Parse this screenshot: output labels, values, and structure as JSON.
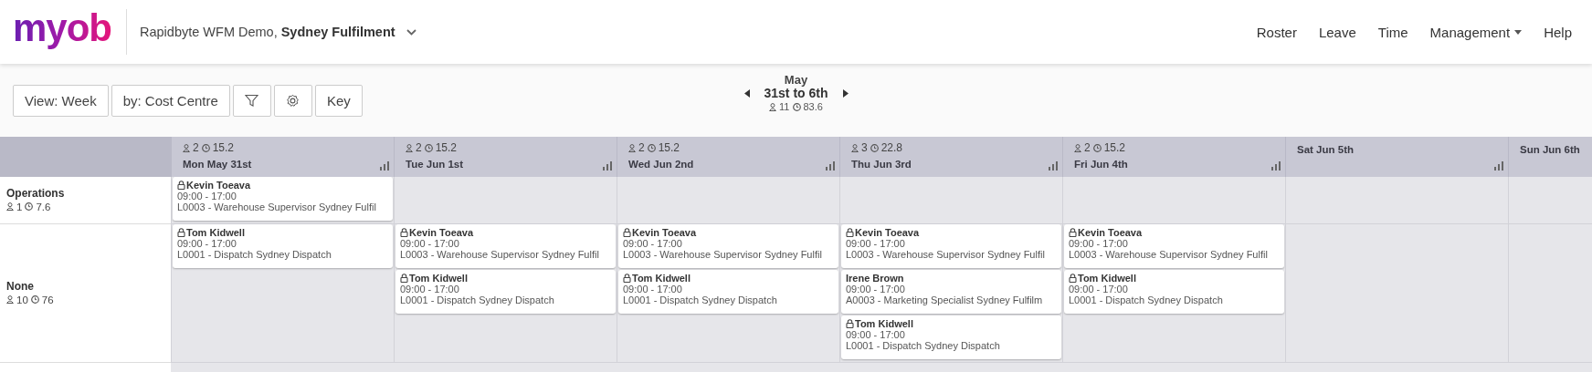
{
  "header": {
    "logo": "myob",
    "business": "Rapidbyte WFM Demo,",
    "location": "Sydney Fulfilment",
    "nav": [
      {
        "label": "Roster",
        "dropdown": false
      },
      {
        "label": "Leave",
        "dropdown": false
      },
      {
        "label": "Time",
        "dropdown": false
      },
      {
        "label": "Management",
        "dropdown": true
      },
      {
        "label": "Help",
        "dropdown": false
      }
    ]
  },
  "toolbar": {
    "buttons": [
      {
        "kind": "text",
        "label": "View: Week"
      },
      {
        "kind": "text",
        "label": "by: Cost Centre"
      },
      {
        "kind": "filter"
      },
      {
        "kind": "settings"
      },
      {
        "kind": "text",
        "label": "Key"
      }
    ],
    "period": {
      "month": "May",
      "range": "31st to 6th",
      "people": "11",
      "hours": "83.6"
    }
  },
  "days": [
    {
      "label": "Mon May 31st",
      "people": "2",
      "hours": "15.2"
    },
    {
      "label": "Tue Jun 1st",
      "people": "2",
      "hours": "15.2"
    },
    {
      "label": "Wed Jun 2nd",
      "people": "2",
      "hours": "15.2"
    },
    {
      "label": "Thu Jun 3rd",
      "people": "3",
      "hours": "22.8"
    },
    {
      "label": "Fri Jun 4th",
      "people": "2",
      "hours": "15.2"
    },
    {
      "label": "Sat Jun 5th"
    },
    {
      "label": "Sun Jun 6th"
    }
  ],
  "rows": [
    {
      "name": "Operations",
      "people": "1",
      "hours": "7.6",
      "days": [
        {
          "kind": "shifts",
          "shifts": [
            {
              "employee": "Kevin Toeava",
              "locked": true,
              "time": "09:00 - 17:00",
              "role": "L0003 - Warehouse Supervisor Sydney Fulfil"
            }
          ]
        },
        {
          "kind": "empty"
        },
        {
          "kind": "empty"
        },
        {
          "kind": "empty"
        },
        {
          "kind": "empty"
        },
        {
          "kind": "empty"
        },
        {
          "kind": "empty"
        }
      ]
    },
    {
      "name": "None",
      "people": "10",
      "hours": "76",
      "days": [
        {
          "kind": "shifts",
          "shifts": [
            {
              "employee": "Tom Kidwell",
              "locked": true,
              "time": "09:00 - 17:00",
              "role": "L0001 - Dispatch Sydney Dispatch"
            }
          ]
        },
        {
          "kind": "shifts",
          "shifts": [
            {
              "employee": "Kevin Toeava",
              "locked": true,
              "time": "09:00 - 17:00",
              "role": "L0003 - Warehouse Supervisor Sydney Fulfil"
            },
            {
              "employee": "Tom Kidwell",
              "locked": true,
              "time": "09:00 - 17:00",
              "role": "L0001 - Dispatch Sydney Dispatch"
            }
          ]
        },
        {
          "kind": "shifts",
          "shifts": [
            {
              "employee": "Kevin Toeava",
              "locked": true,
              "time": "09:00 - 17:00",
              "role": "L0003 - Warehouse Supervisor Sydney Fulfil"
            },
            {
              "employee": "Tom Kidwell",
              "locked": true,
              "time": "09:00 - 17:00",
              "role": "L0001 - Dispatch Sydney Dispatch"
            }
          ]
        },
        {
          "kind": "shifts",
          "shifts": [
            {
              "employee": "Kevin Toeava",
              "locked": true,
              "time": "09:00 - 17:00",
              "role": "L0003 - Warehouse Supervisor Sydney Fulfil"
            },
            {
              "employee": "Irene Brown",
              "locked": false,
              "time": "09:00 - 17:00",
              "role": "A0003 - Marketing Specialist Sydney Fulfilm"
            },
            {
              "employee": "Tom Kidwell",
              "locked": true,
              "time": "09:00 - 17:00",
              "role": "L0001 - Dispatch Sydney Dispatch"
            }
          ]
        },
        {
          "kind": "shifts",
          "shifts": [
            {
              "employee": "Kevin Toeava",
              "locked": true,
              "time": "09:00 - 17:00",
              "role": "L0003 - Warehouse Supervisor Sydney Fulfil"
            },
            {
              "employee": "Tom Kidwell",
              "locked": true,
              "time": "09:00 - 17:00",
              "role": "L0001 - Dispatch Sydney Dispatch"
            }
          ]
        },
        {
          "kind": "empty"
        },
        {
          "kind": "empty"
        }
      ]
    }
  ]
}
